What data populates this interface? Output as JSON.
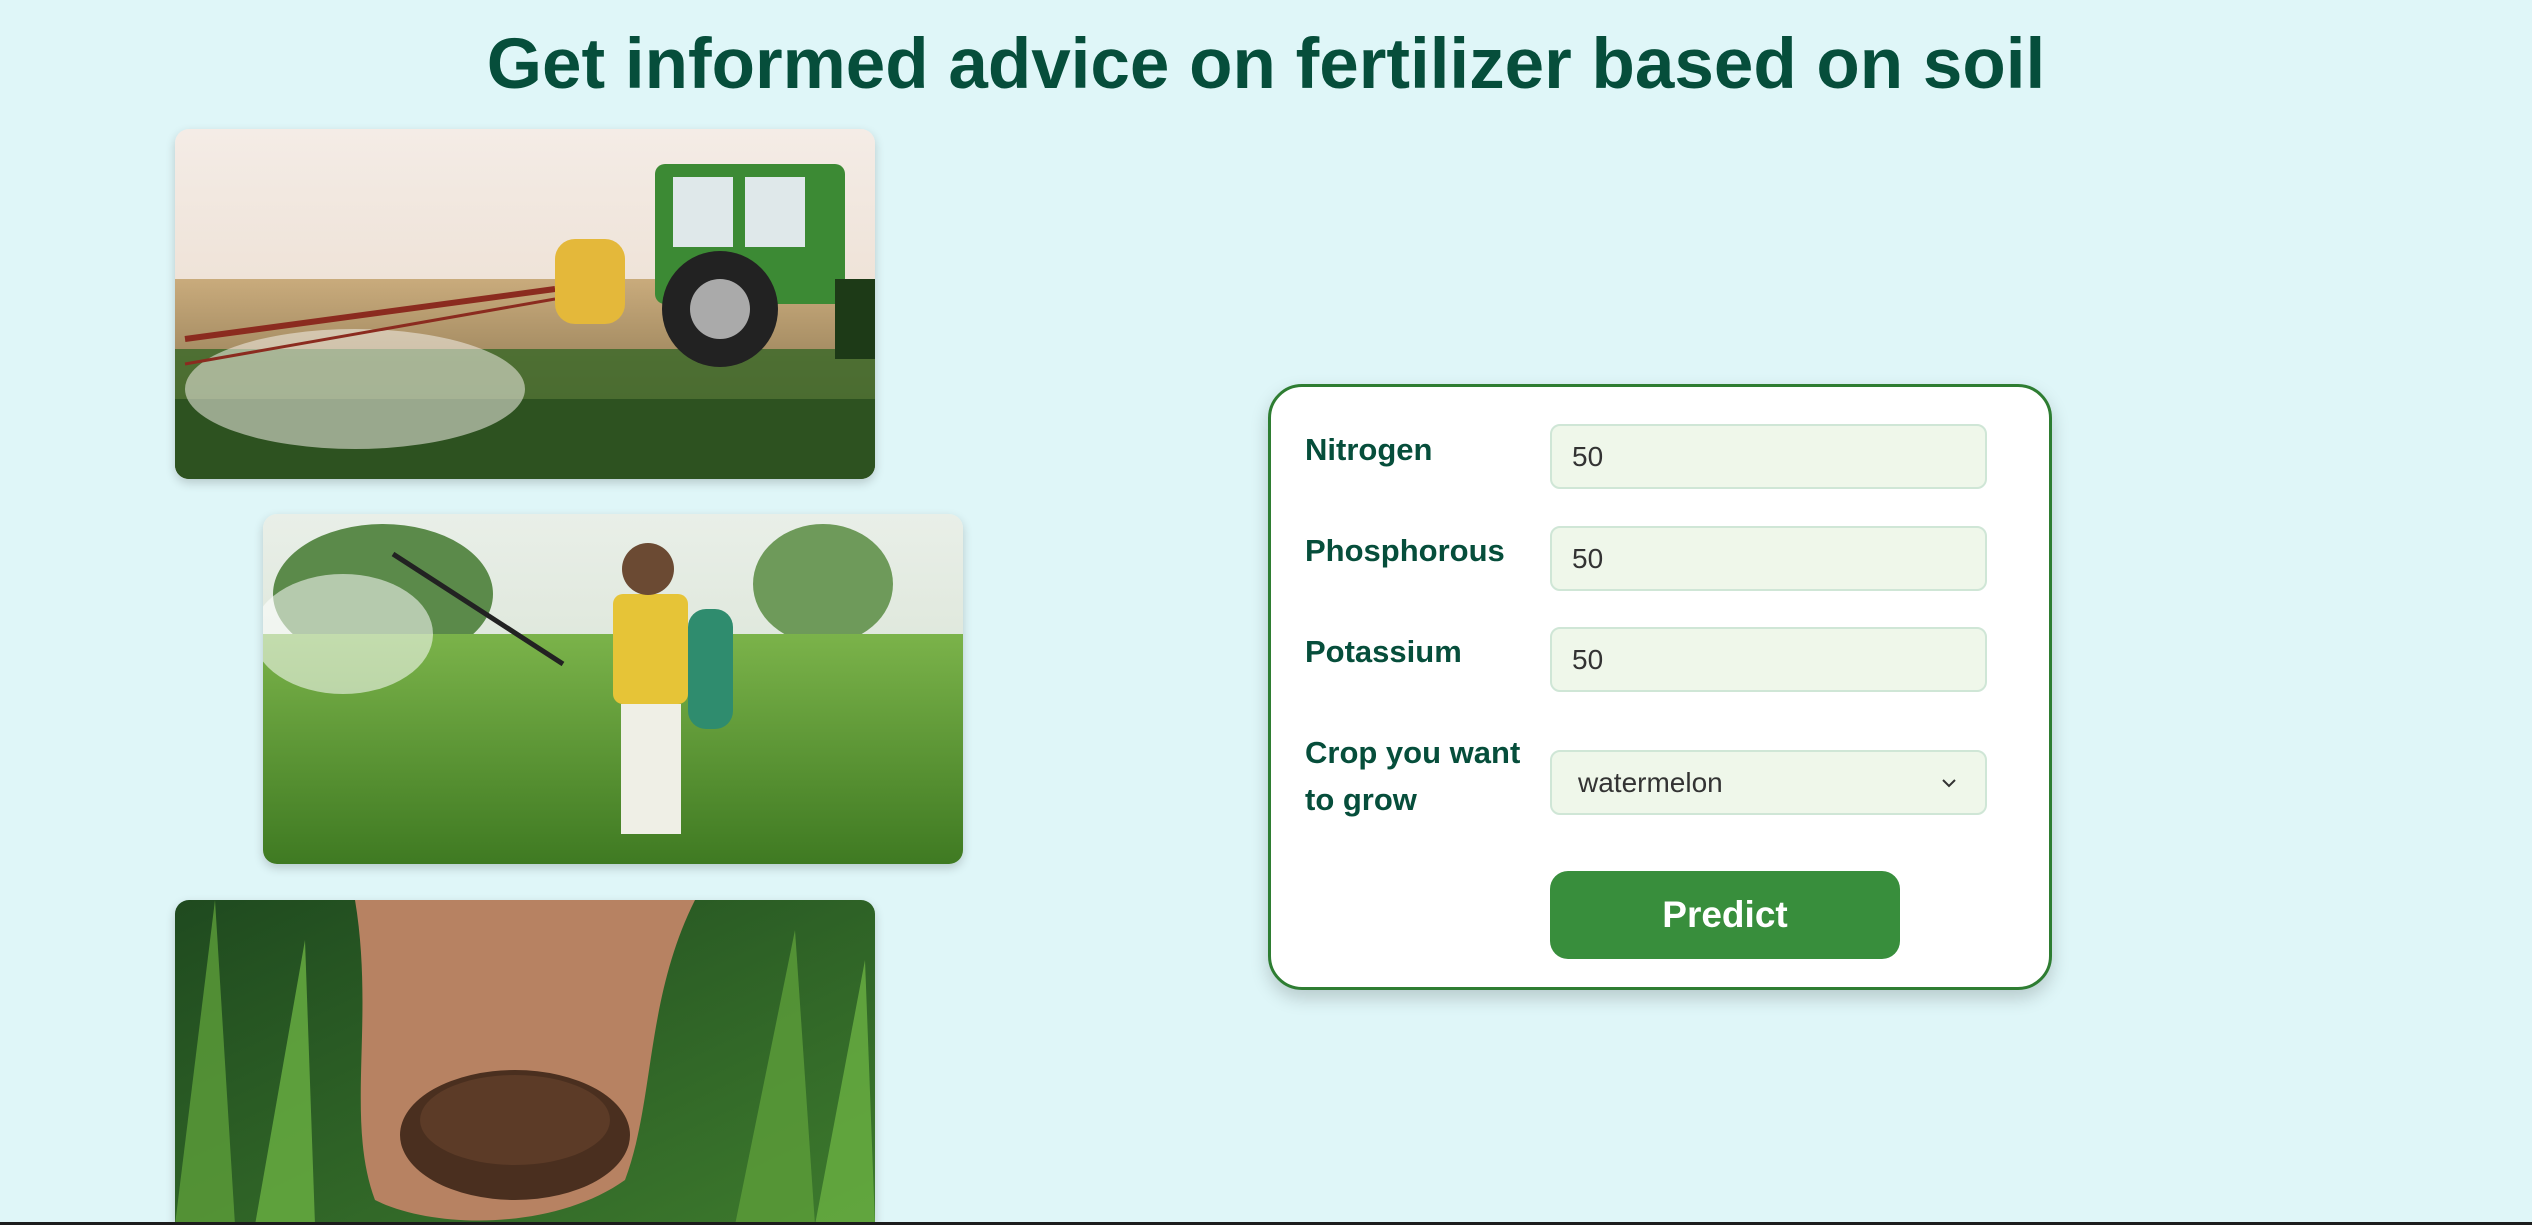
{
  "page": {
    "title": "Get informed advice on fertilizer based on soil"
  },
  "images": [
    {
      "name": "tractor-spraying-field-image"
    },
    {
      "name": "farmer-spraying-crops-image"
    },
    {
      "name": "hands-holding-fertilizer-image"
    }
  ],
  "form": {
    "fields": [
      {
        "label": "Nitrogen",
        "value": "50"
      },
      {
        "label": "Phosphorous",
        "value": "50"
      },
      {
        "label": "Potassium",
        "value": "50"
      }
    ],
    "crop": {
      "label": "Crop you want to grow",
      "selected": "watermelon"
    },
    "submit_label": "Predict"
  },
  "colors": {
    "background": "#dff6f8",
    "title": "#064e3b",
    "accent": "#388e3c",
    "card_border": "#2e7d32",
    "input_bg": "#eff7ea"
  }
}
